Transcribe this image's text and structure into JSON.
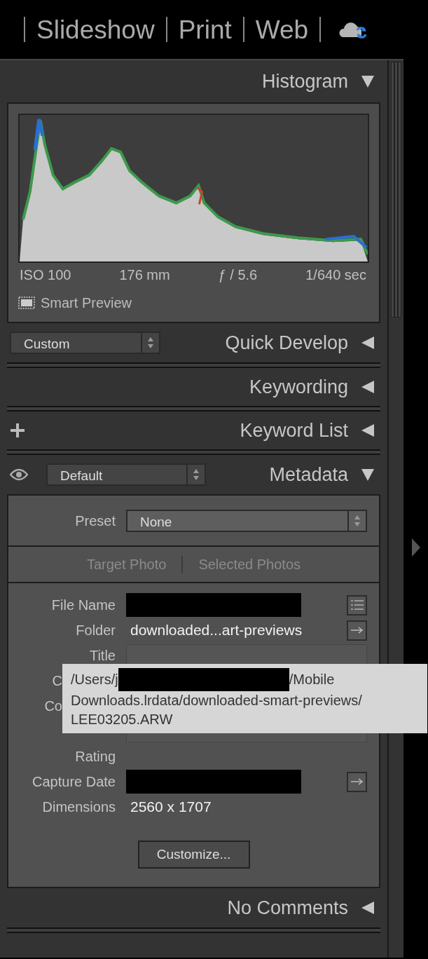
{
  "modules": [
    {
      "label": "Slideshow",
      "selected": false
    },
    {
      "label": "Print",
      "selected": false
    },
    {
      "label": "Web",
      "selected": false
    }
  ],
  "histogram": {
    "title": "Histogram",
    "expanded": true,
    "info": [
      "ISO 100",
      "176 mm",
      "ƒ / 5.6",
      "1/640 sec"
    ],
    "smart_preview": "Smart Preview"
  },
  "quick_develop": {
    "title": "Quick Develop",
    "expanded": false,
    "preset": "Custom"
  },
  "keywording": {
    "title": "Keywording",
    "expanded": false
  },
  "keyword_list": {
    "title": "Keyword List",
    "expanded": false
  },
  "metadata": {
    "title": "Metadata",
    "expanded": true,
    "view": "Default",
    "preset_label": "Preset",
    "preset_value": "None",
    "tabs": [
      {
        "label": "Target Photo",
        "selected": false
      },
      {
        "label": "Selected Photos",
        "selected": false
      }
    ],
    "fields": [
      {
        "label": "File Name",
        "kind": "redacted",
        "button": {
          "kind": "list"
        }
      },
      {
        "label": "Folder",
        "kind": "text",
        "value": "downloaded...art-previews",
        "button": {
          "kind": "arrow"
        }
      },
      {
        "label": "Title",
        "kind": "field"
      },
      {
        "label": "C",
        "kind": "covered"
      },
      {
        "label": "Co",
        "kind": "covered"
      },
      {
        "kind": "field"
      },
      {
        "label": "Rating",
        "kind": "text"
      },
      {
        "label": "Capture Date",
        "kind": "redacted",
        "button": {
          "kind": "arrow"
        }
      },
      {
        "label": "Dimensions",
        "kind": "text",
        "value": "2560 x 1707"
      }
    ],
    "customize": "Customize..."
  },
  "comments": {
    "title": "No Comments",
    "expanded": false
  },
  "tooltip": {
    "path_start": "/Users/j",
    "path_end": "/Mobile",
    "lines": [
      "Downloads.lrdata/downloaded-smart-previews/",
      "LEE03205.ARW"
    ]
  }
}
